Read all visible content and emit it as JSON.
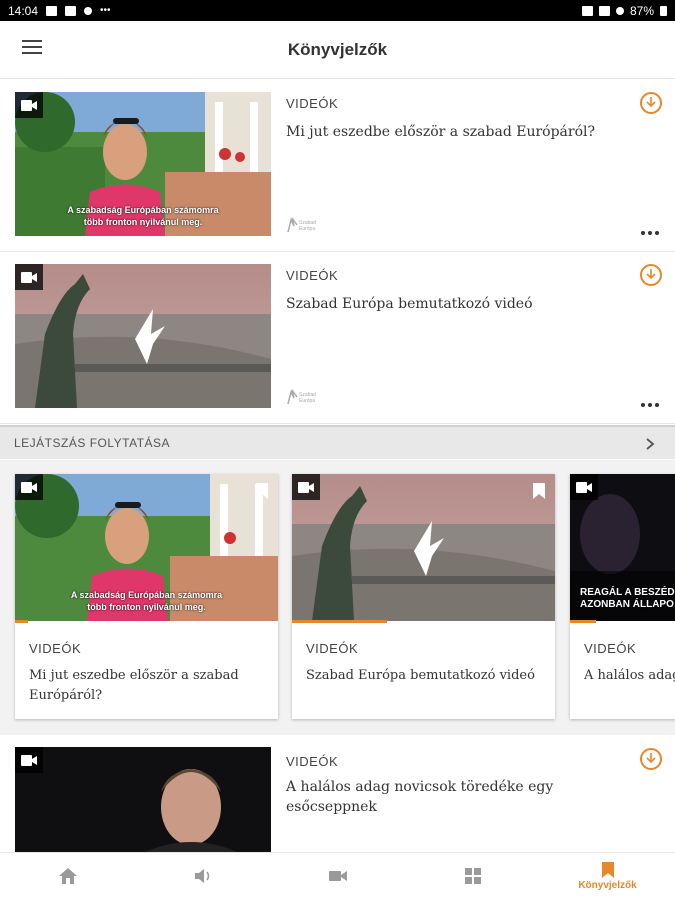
{
  "status_bar": {
    "time": "14:04",
    "battery": "87%"
  },
  "app_bar": {
    "title": "Könyvjelzők"
  },
  "bookmarks": [
    {
      "category": "VIDEÓK",
      "title": "Mi jut eszedbe először a szabad Európáról?",
      "caption_line1": "A szabadság Európában számomra",
      "caption_line2": "több fronton nyilvánul meg.",
      "logo_text": "Szabad Európa"
    },
    {
      "category": "VIDEÓK",
      "title": "Szabad Európa bemutatkozó videó",
      "logo_text": "Szabad Európa"
    },
    {
      "category": "VIDEÓK",
      "title": "A halálos adag novicsok töredéke egy esőcseppnek"
    }
  ],
  "continue_section": {
    "label": "LEJÁTSZÁS FOLYTATÁSA"
  },
  "continue_cards": [
    {
      "category": "VIDEÓK",
      "title": "Mi jut eszedbe először a szabad Európáról?",
      "caption_line1": "A szabadság Európában számomra",
      "caption_line2": "több fronton nyilvánul meg.",
      "progress": 0.05
    },
    {
      "category": "VIDEÓK",
      "title": "Szabad Európa bemutatkozó videó",
      "progress": 0.36
    },
    {
      "category": "VIDEÓK",
      "title": "A halálos adag egy esőcseppn",
      "caption_line1": "REAGÁL A BESZÉDR",
      "caption_line2": "AZONBAN ÁLLAPO",
      "progress": 0.1
    }
  ],
  "bottom_nav": [
    {
      "icon": "home-icon",
      "label": ""
    },
    {
      "icon": "audio-icon",
      "label": ""
    },
    {
      "icon": "video-icon",
      "label": ""
    },
    {
      "icon": "grid-icon",
      "label": ""
    },
    {
      "icon": "bookmark-icon",
      "label": "Könyvjelzők"
    }
  ],
  "colors": {
    "accent": "#e8872a",
    "section_bg": "#e8e8e8"
  }
}
